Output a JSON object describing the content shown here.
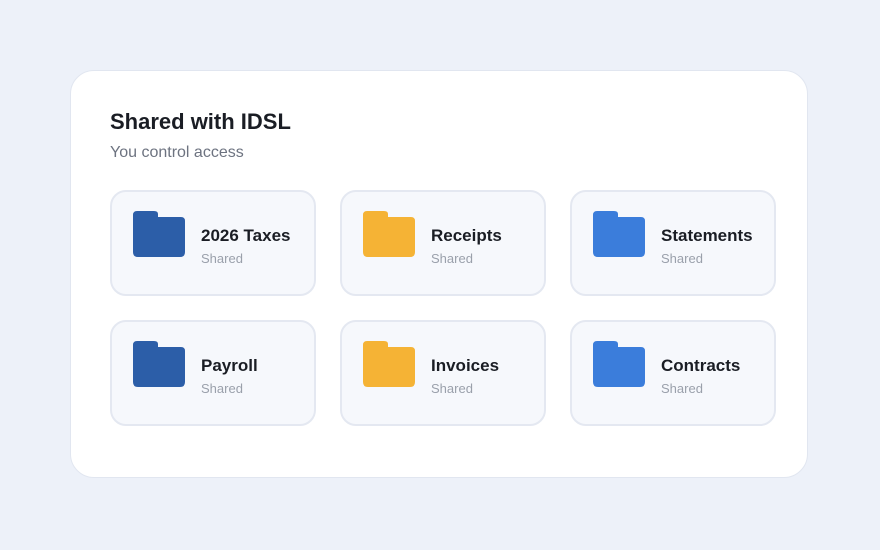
{
  "panel": {
    "title": "Shared with IDSL",
    "subtitle": "You control access"
  },
  "folders": [
    {
      "name": "2026 Taxes",
      "status": "Shared",
      "color": "#2c5ea8",
      "icon": "folder-icon"
    },
    {
      "name": "Receipts",
      "status": "Shared",
      "color": "#f5b335",
      "icon": "folder-icon"
    },
    {
      "name": "Statements",
      "status": "Shared",
      "color": "#3b7ddb",
      "icon": "folder-icon"
    },
    {
      "name": "Payroll",
      "status": "Shared",
      "color": "#2c5ea8",
      "icon": "folder-icon"
    },
    {
      "name": "Invoices",
      "status": "Shared",
      "color": "#f5b335",
      "icon": "folder-icon"
    },
    {
      "name": "Contracts",
      "status": "Shared",
      "color": "#3b7ddb",
      "icon": "folder-icon"
    }
  ]
}
